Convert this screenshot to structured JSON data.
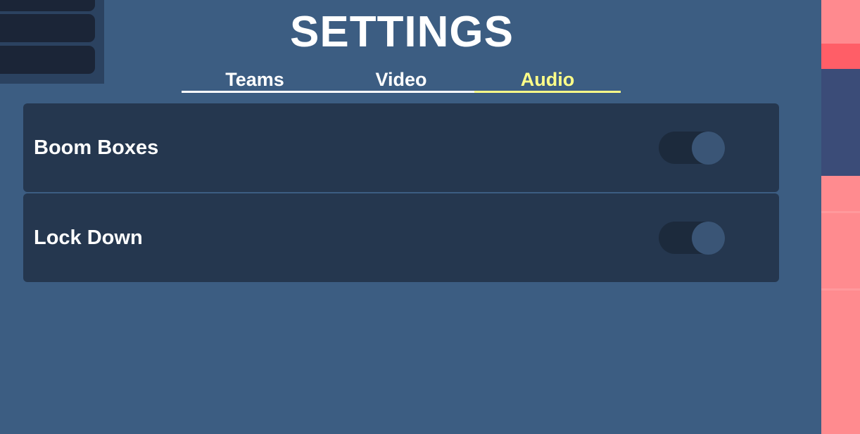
{
  "title": "SETTINGS",
  "tabs": [
    {
      "label": "Teams",
      "active": false
    },
    {
      "label": "Video",
      "active": false
    },
    {
      "label": "Audio",
      "active": true
    }
  ],
  "settings": [
    {
      "label": "Boom Boxes",
      "enabled": false
    },
    {
      "label": "Lock Down",
      "enabled": false
    }
  ],
  "colors": {
    "background": "#3c5d82",
    "row": "#25374f",
    "active_tab": "#ffff88",
    "toggle_track": "#1c2a3c",
    "toggle_knob": "#3a5576"
  }
}
